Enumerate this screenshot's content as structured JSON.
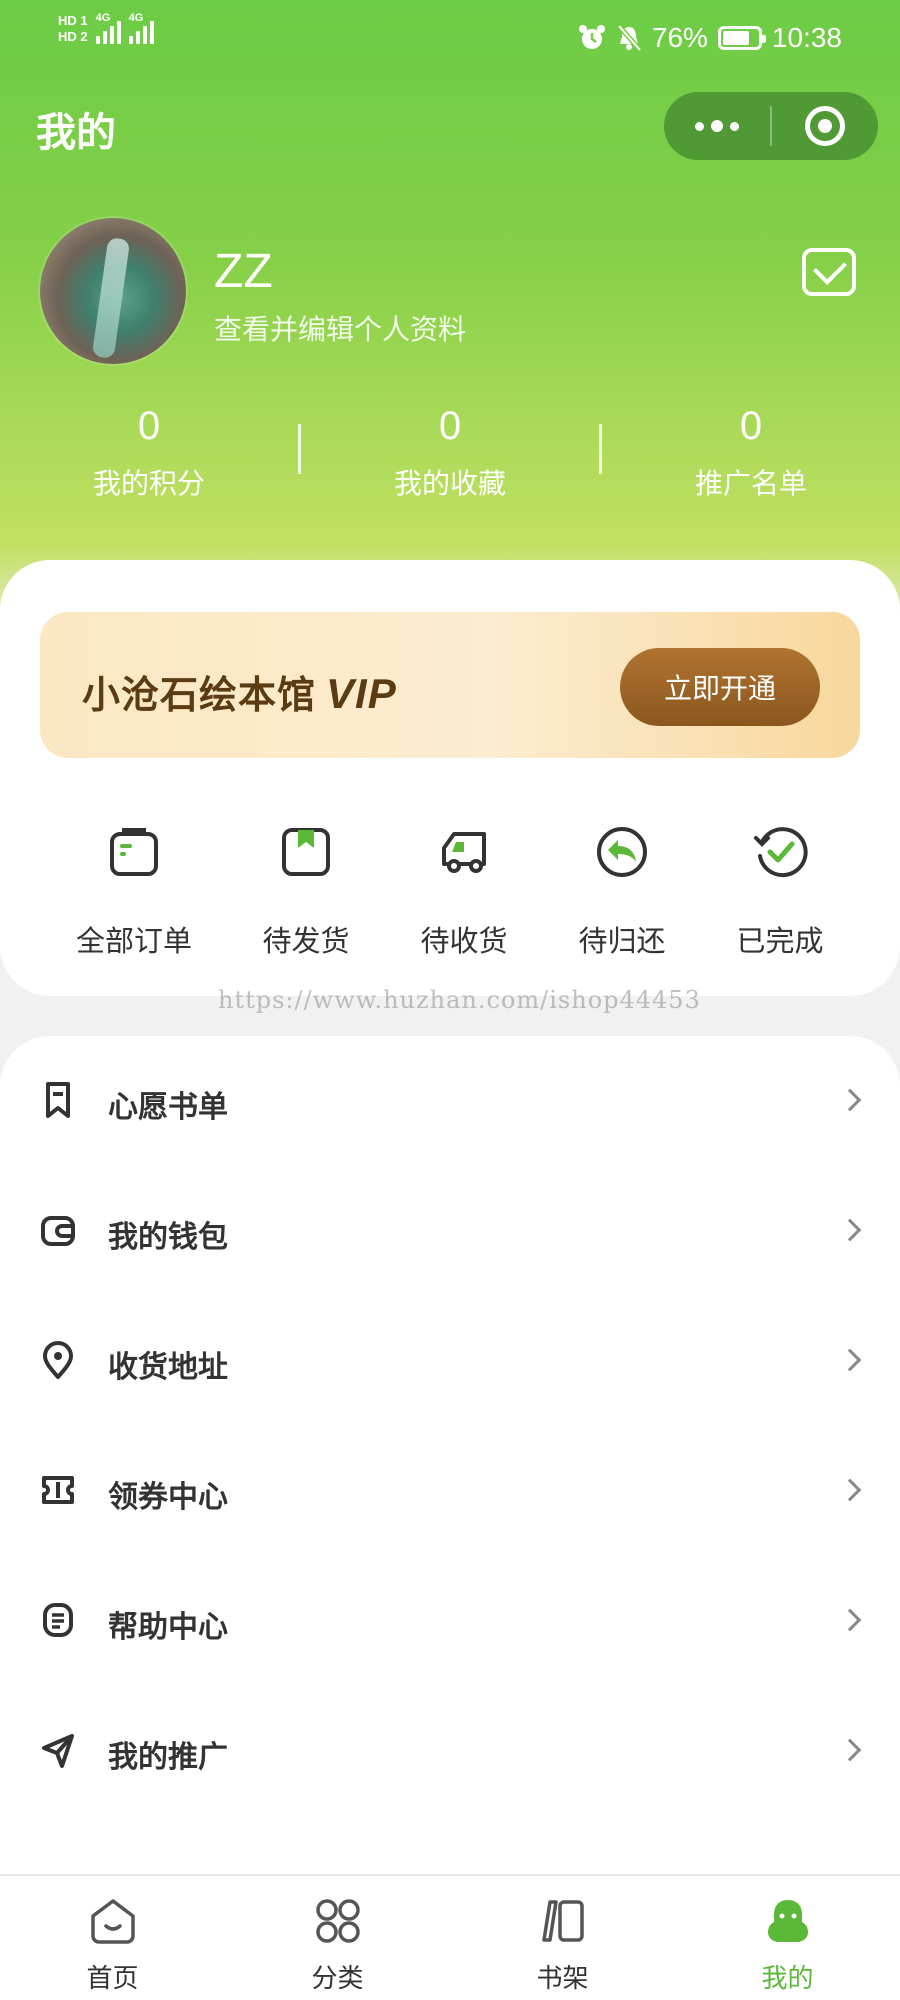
{
  "status_bar": {
    "sim1": "HD 1",
    "sim2": "HD 2",
    "network1": "4G",
    "network2": "4G",
    "battery_percent": "76%",
    "battery_level": 0.76,
    "time": "10:38",
    "icons": [
      "alarm-icon",
      "bell-muted-icon",
      "battery-icon"
    ]
  },
  "header": {
    "title": "我的"
  },
  "profile": {
    "username": "ZZ",
    "hint": "查看并编辑个人资料"
  },
  "stats": [
    {
      "value": "0",
      "label": "我的积分"
    },
    {
      "value": "0",
      "label": "我的收藏"
    },
    {
      "value": "0",
      "label": "推广名单"
    }
  ],
  "vip": {
    "title": "小沧石绘本馆",
    "badge": "VIP",
    "button": "立即开通"
  },
  "orders": [
    {
      "label": "全部订单",
      "icon": "bag-icon"
    },
    {
      "label": "待发货",
      "icon": "package-icon"
    },
    {
      "label": "待收货",
      "icon": "truck-icon"
    },
    {
      "label": "待归还",
      "icon": "return-icon"
    },
    {
      "label": "已完成",
      "icon": "check-circle-icon"
    }
  ],
  "watermark": "https://www.huzhan.com/ishop44453",
  "menu": [
    {
      "label": "心愿书单",
      "icon": "bookmark-icon"
    },
    {
      "label": "我的钱包",
      "icon": "wallet-icon"
    },
    {
      "label": "收货地址",
      "icon": "location-icon"
    },
    {
      "label": "领券中心",
      "icon": "coupon-icon"
    },
    {
      "label": "帮助中心",
      "icon": "document-icon"
    },
    {
      "label": "我的推广",
      "icon": "send-icon"
    }
  ],
  "tabbar": [
    {
      "label": "首页",
      "icon": "home-icon",
      "active": false
    },
    {
      "label": "分类",
      "icon": "grid-icon",
      "active": false
    },
    {
      "label": "书架",
      "icon": "bookshelf-icon",
      "active": false
    },
    {
      "label": "我的",
      "icon": "user-icon",
      "active": true
    }
  ],
  "colors": {
    "primary_green": "#6ccb45",
    "active_tab": "#5cb839",
    "vip_brown": "#8b561e"
  }
}
